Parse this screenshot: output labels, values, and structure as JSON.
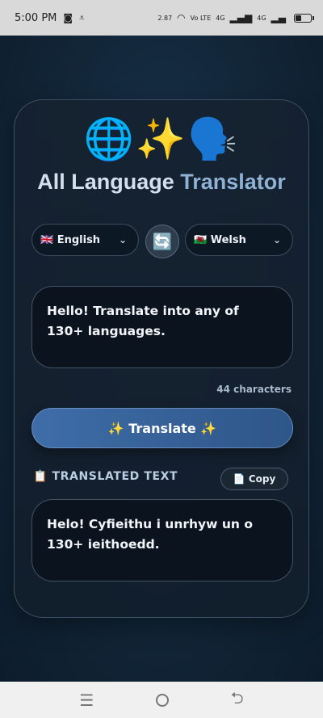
{
  "status_bar": {
    "time": "5:00 PM",
    "speed": "2.87",
    "signal_label": "4G",
    "lte": "Vo LTE"
  },
  "app": {
    "header_emojis": "🌐✨🗣️",
    "title_main": "All Language ",
    "title_accent": "Translator",
    "source_language": {
      "flag": "🇬🇧",
      "name": "English"
    },
    "target_language": {
      "flag": "🏴󠁧󠁢󠁷󠁬󠁳󠁿",
      "name": "Welsh"
    },
    "swap_icon": "🔄",
    "source_text": "Hello! Translate into any of 130+ languages.",
    "char_count": "44 characters",
    "translate_label": "✨ Translate ✨",
    "result_label": "📋 TRANSLATED TEXT",
    "copy_label": "📄 Copy",
    "result_text": "Helo! Cyfieithu i unrhyw un o 130+ ieithoedd."
  },
  "colors": {
    "background": "#0f2235",
    "card": "#16222f",
    "accent_button": "#3f6da8",
    "title_accent": "#8fb1d4"
  },
  "nav_bar": {
    "menu_icon": "☰",
    "back_icon": "⮌"
  }
}
